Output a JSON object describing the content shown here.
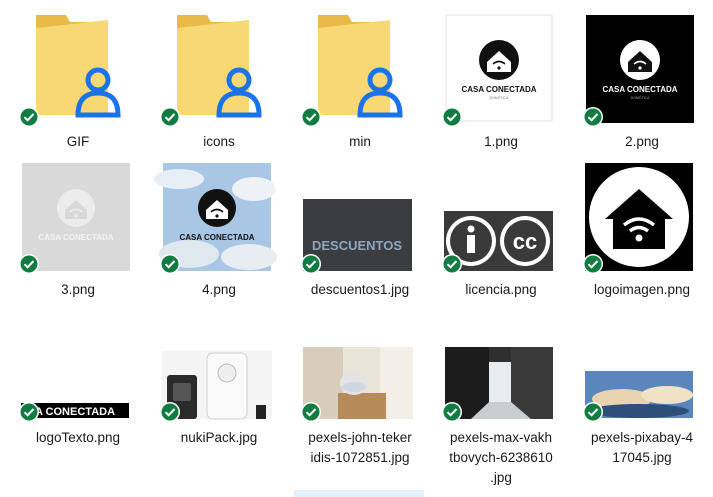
{
  "items": [
    {
      "name": "GIF",
      "type": "folder",
      "sync": "synced-check-icon"
    },
    {
      "name": "icons",
      "type": "folder",
      "sync": "synced-check-icon"
    },
    {
      "name": "min",
      "type": "folder",
      "sync": "synced-check-icon"
    },
    {
      "name": "1.png",
      "type": "image",
      "thumb_text": "CASA CONECTADA",
      "thumb_subtext": "DOMÓTICA",
      "sync": "synced-check-icon"
    },
    {
      "name": "2.png",
      "type": "image",
      "thumb_text": "CASA CONECTADA",
      "thumb_subtext": "DOMÓTICA",
      "sync": "synced-check-icon"
    },
    {
      "name": "3.png",
      "type": "image",
      "thumb_text": "CASA CONECTADA",
      "sync": "synced-check-icon"
    },
    {
      "name": "4.png",
      "type": "image",
      "thumb_text": "CASA CONECTADA",
      "sync": "synced-check-icon"
    },
    {
      "name": "descuentos1.jpg",
      "type": "image",
      "thumb_text": "DESCUENTOS",
      "sync": "synced-check-icon"
    },
    {
      "name": "licencia.png",
      "type": "image",
      "thumb_text": "cc",
      "sync": "synced-check-icon"
    },
    {
      "name": "logoimagen.png",
      "type": "image",
      "sync": "synced-check-icon"
    },
    {
      "name": "logoTexto.png",
      "type": "image",
      "thumb_text": "A CONECTADA",
      "sync": "synced-check-icon"
    },
    {
      "name": "nukiPack.jpg",
      "type": "image",
      "sync": "synced-check-icon"
    },
    {
      "name": "pexels-john-tekeridis-1072851.jpg",
      "label_lines": [
        "pexels-john-teker",
        "idis-1072851.jpg"
      ],
      "type": "image",
      "sync": "synced-check-icon"
    },
    {
      "name": "pexels-max-vakhtbovych-6238610.jpg",
      "label_lines": [
        "pexels-max-vakh",
        "tbovych-6238610",
        ".jpg"
      ],
      "type": "image",
      "sync": "synced-check-icon"
    },
    {
      "name": "pexels-pixabay-417045.jpg",
      "label_lines": [
        "pexels-pixabay-4",
        "17045.jpg"
      ],
      "type": "image",
      "sync": "synced-check-icon"
    }
  ],
  "colors": {
    "folder": "#f8d775",
    "folder_dark": "#e9b949",
    "user_badge": "#1a73e8",
    "sync_green": "#107c41"
  }
}
